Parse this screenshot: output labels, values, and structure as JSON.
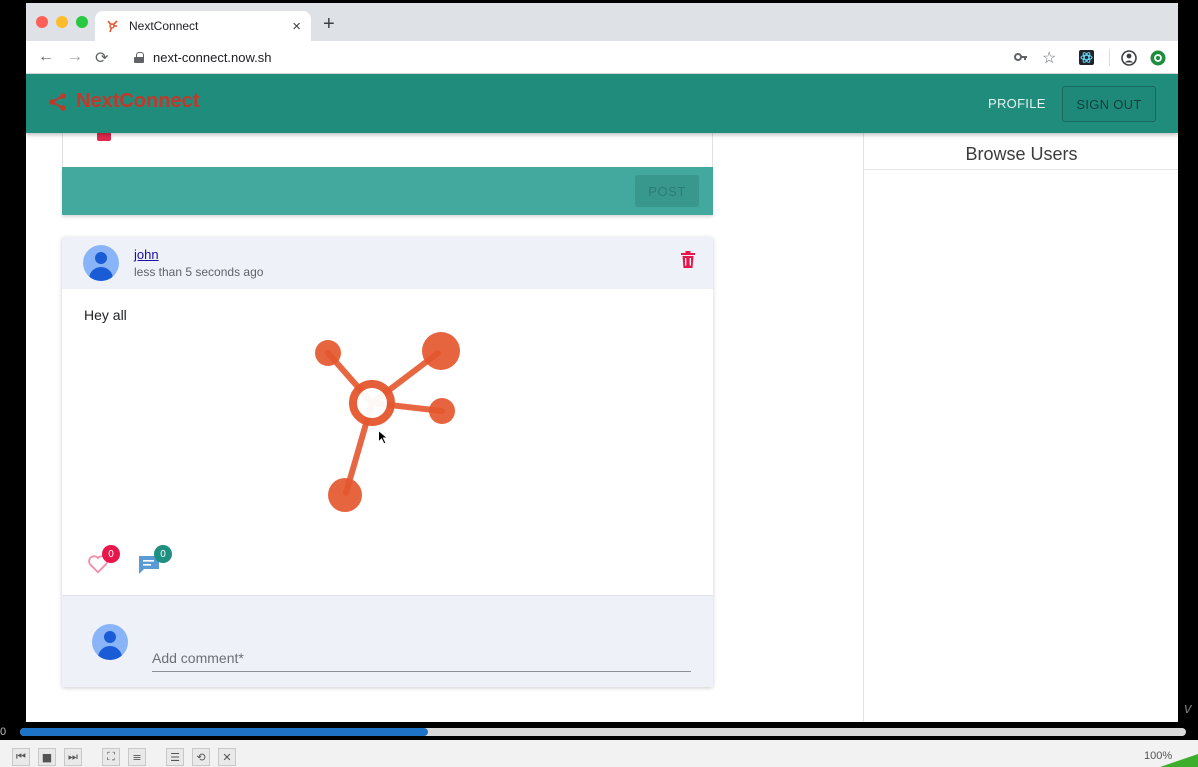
{
  "browser": {
    "tab_title": "NextConnect",
    "new_tab_symbol": "+",
    "close_symbol": "×",
    "url": "next-connect.now.sh"
  },
  "app": {
    "brand": "NextConnect",
    "nav": {
      "profile": "PROFILE",
      "sign_out": "SIGN OUT"
    }
  },
  "composer": {
    "post_label": "POST"
  },
  "post": {
    "author": "john",
    "time": "less than 5 seconds ago",
    "text": "Hey all",
    "likes": "0",
    "comments": "0",
    "comment_placeholder": "Add comment*"
  },
  "sidebar": {
    "title": "Browse Users"
  },
  "player": {
    "progress": 0.35,
    "volume_label": "100%",
    "time_left": "0"
  },
  "colors": {
    "header": "#208c7c",
    "brand_text": "#c0392b",
    "composer_bar": "#43a99e",
    "like_badge": "#e8174b",
    "comment_badge": "#1f8f7f",
    "progress": "#1e73c6"
  }
}
